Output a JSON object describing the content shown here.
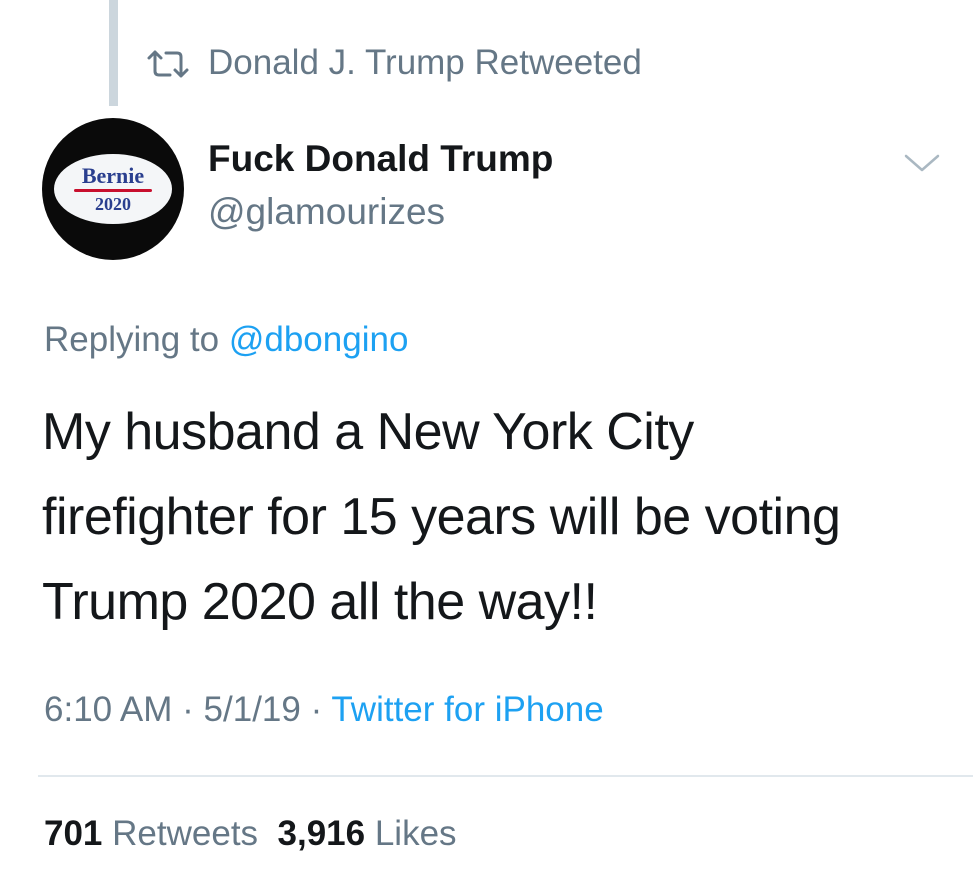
{
  "retweet_context": {
    "icon": "retweet-icon",
    "label": "Donald J. Trump Retweeted"
  },
  "author": {
    "avatar_text_top": "Bernie",
    "avatar_text_bottom": "2020",
    "display_name": "Fuck Donald Trump",
    "handle": "@glamourizes"
  },
  "caret_icon": "chevron-down-icon",
  "reply": {
    "prefix": "Replying to",
    "mention": "@dbongino"
  },
  "tweet": {
    "line1": "My husband a New York City",
    "line2": "firefighter for 15 years will be voting",
    "line3": "Trump 2020 all the way!!"
  },
  "meta": {
    "time": "6:10 AM",
    "separator1": "·",
    "date": "5/1/19",
    "separator2": "·",
    "source": "Twitter for iPhone"
  },
  "stats": {
    "retweets_count": "701",
    "retweets_label": "Retweets",
    "likes_count": "3,916",
    "likes_label": "Likes"
  },
  "colors": {
    "text_primary": "#14171a",
    "text_secondary": "#657786",
    "link": "#1da1f2",
    "divider": "#e1e8ed",
    "thread_line": "#ccd6dd"
  }
}
